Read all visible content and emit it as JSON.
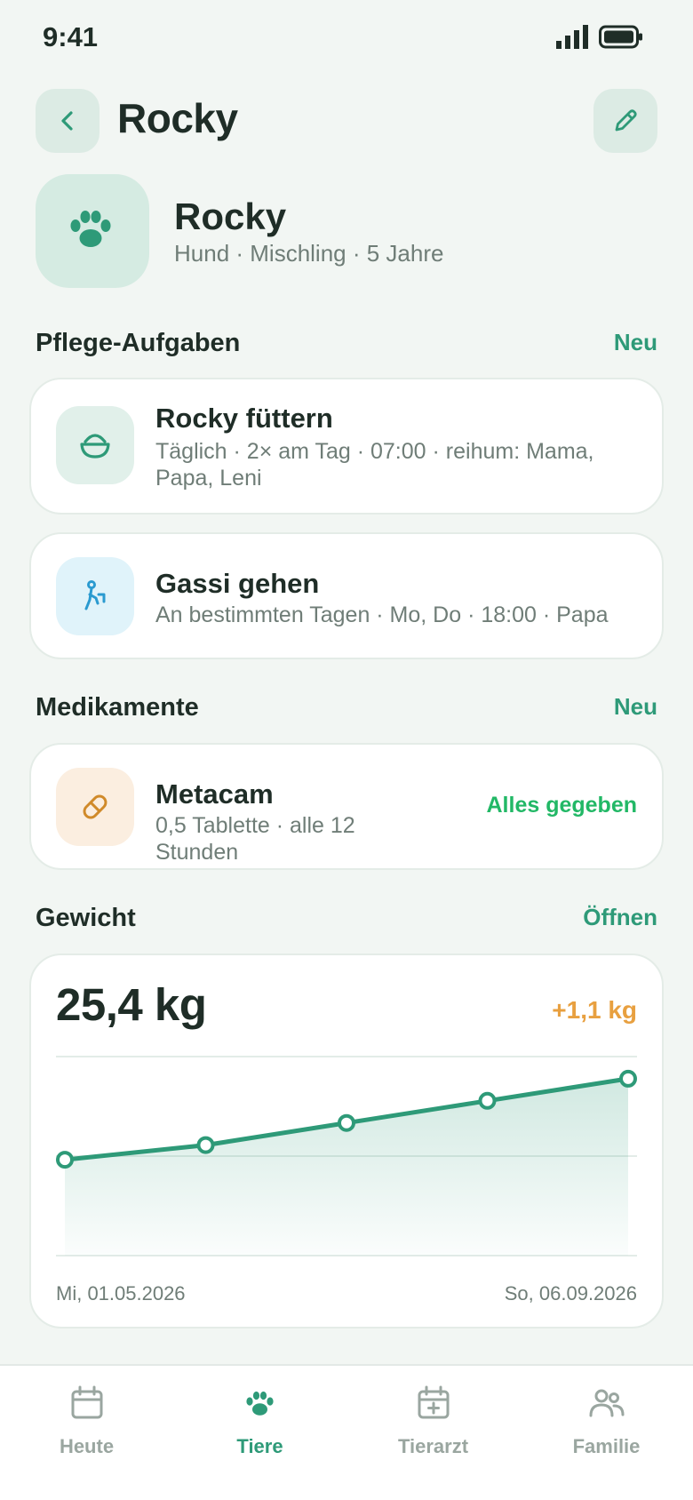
{
  "status_bar": {
    "time": "9:41"
  },
  "header": {
    "title": "Rocky"
  },
  "profile": {
    "name": "Rocky",
    "subtitle": "Hund · Mischling · 5 Jahre"
  },
  "care": {
    "title": "Pflege-Aufgaben",
    "new_label": "Neu",
    "tasks": [
      {
        "title": "Rocky füttern",
        "subtitle": "Täglich · 2× am Tag · 07:00 · reihum: Mama, Papa, Leni",
        "icon": "food-bowl-icon"
      },
      {
        "title": "Gassi gehen",
        "subtitle": "An bestimmten Tagen · Mo, Do · 18:00 · Papa",
        "icon": "walking-icon"
      }
    ]
  },
  "medications": {
    "title": "Medikamente",
    "new_label": "Neu",
    "items": [
      {
        "title": "Metacam",
        "subtitle": "0,5 Tablette · alle 12 Stunden",
        "status": "Alles gegeben",
        "icon": "pill-icon"
      }
    ]
  },
  "weight": {
    "title": "Gewicht",
    "open_label": "Öffnen",
    "value": "25,4 kg",
    "delta": "+1,1 kg"
  },
  "chart_data": {
    "type": "area",
    "x_labels": [
      "Mi, 01.05.2026",
      "So, 06.09.2026"
    ],
    "values": [
      24.3,
      24.5,
      24.8,
      25.1,
      25.4
    ],
    "ylim": [
      23.0,
      25.7
    ],
    "grid": true,
    "colors": {
      "line": "#2e9a78",
      "fill": "#2e9a78"
    }
  },
  "tabs": [
    {
      "label": "Heute",
      "icon": "calendar-icon",
      "active": false
    },
    {
      "label": "Tiere",
      "icon": "paw-icon",
      "active": true
    },
    {
      "label": "Tierarzt",
      "icon": "vet-calendar-icon",
      "active": false
    },
    {
      "label": "Familie",
      "icon": "family-icon",
      "active": false
    }
  ],
  "colors": {
    "accent": "#2e9a78",
    "background": "#f2f6f3",
    "success": "#22b866",
    "warning": "#e8a040"
  }
}
